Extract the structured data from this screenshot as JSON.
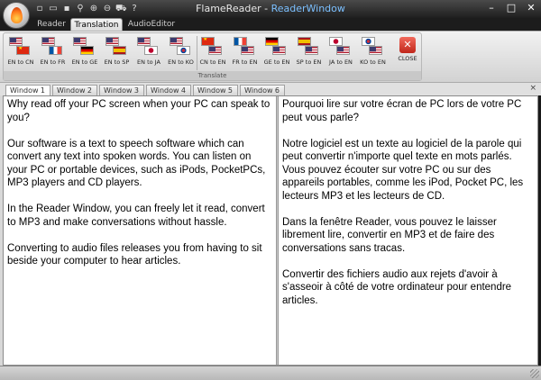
{
  "window": {
    "app_name": "FlameReader",
    "separator": " - ",
    "sub_name": "ReaderWindow",
    "controls": {
      "minimize": "–",
      "maximize": "□",
      "close": "✕"
    }
  },
  "quick_access": [
    "new-icon",
    "open-icon",
    "save-icon",
    "search-icon",
    "zoom-in-icon",
    "zoom-out-icon",
    "cart-icon",
    "help-icon"
  ],
  "ribbon_tabs": [
    {
      "label": "Reader",
      "active": false
    },
    {
      "label": "Translation",
      "active": true
    },
    {
      "label": "AudioEditor",
      "active": false
    }
  ],
  "ribbon": {
    "group_label": "Translate",
    "buttons": [
      {
        "label": "EN to CN",
        "from": "us",
        "to": "cn"
      },
      {
        "label": "EN to FR",
        "from": "us",
        "to": "fr"
      },
      {
        "label": "EN to GE",
        "from": "us",
        "to": "de"
      },
      {
        "label": "EN to SP",
        "from": "us",
        "to": "es"
      },
      {
        "label": "EN to JA",
        "from": "us",
        "to": "ja"
      },
      {
        "label": "EN to KO",
        "from": "us",
        "to": "ko"
      },
      {
        "label": "CN to EN",
        "from": "cn",
        "to": "us"
      },
      {
        "label": "FR to EN",
        "from": "fr",
        "to": "us"
      },
      {
        "label": "GE to EN",
        "from": "de",
        "to": "us"
      },
      {
        "label": "SP to EN",
        "from": "es",
        "to": "us"
      },
      {
        "label": "JA to EN",
        "from": "ja",
        "to": "us"
      },
      {
        "label": "KO to EN",
        "from": "ko",
        "to": "us"
      }
    ],
    "close_label": "CLOSE",
    "close_glyph": "✕"
  },
  "doc_tabs": [
    {
      "label": "Window",
      "num": "1",
      "active": true
    },
    {
      "label": "Window",
      "num": "2",
      "active": false
    },
    {
      "label": "Window",
      "num": "3",
      "active": false
    },
    {
      "label": "Window",
      "num": "4",
      "active": false
    },
    {
      "label": "Window",
      "num": "5",
      "active": false
    },
    {
      "label": "Window",
      "num": "6",
      "active": false
    }
  ],
  "doc_close": "×",
  "editor": {
    "left": [
      " Why read off your PC screen when your PC can speak to you?",
      "Our software  is a text to speech software which can convert any text into spoken words. You can listen on your PC or portable devices, such as iPods, PocketPCs, MP3 players and CD players.",
      "In the Reader Window, you can freely let it read, convert to MP3 and make conversations without hassle.",
      "Converting to audio files releases you from having to sit beside your computer to hear articles."
    ],
    "right": [
      "Pourquoi lire sur votre écran de PC lors de votre PC peut vous parle?",
      "Notre logiciel est un texte au logiciel de la parole qui peut convertir n'importe quel texte en mots parlés. Vous pouvez écouter sur votre PC ou sur des appareils portables, comme les iPod, Pocket PC, les lecteurs MP3 et les lecteurs de CD.",
      "Dans la fenêtre Reader, vous pouvez le laisser librement lire, convertir en MP3 et de faire des conversations sans tracas.",
      "Convertir des fichiers audio aux rejets d'avoir à s'asseoir à côté de votre ordinateur pour entendre articles."
    ]
  }
}
